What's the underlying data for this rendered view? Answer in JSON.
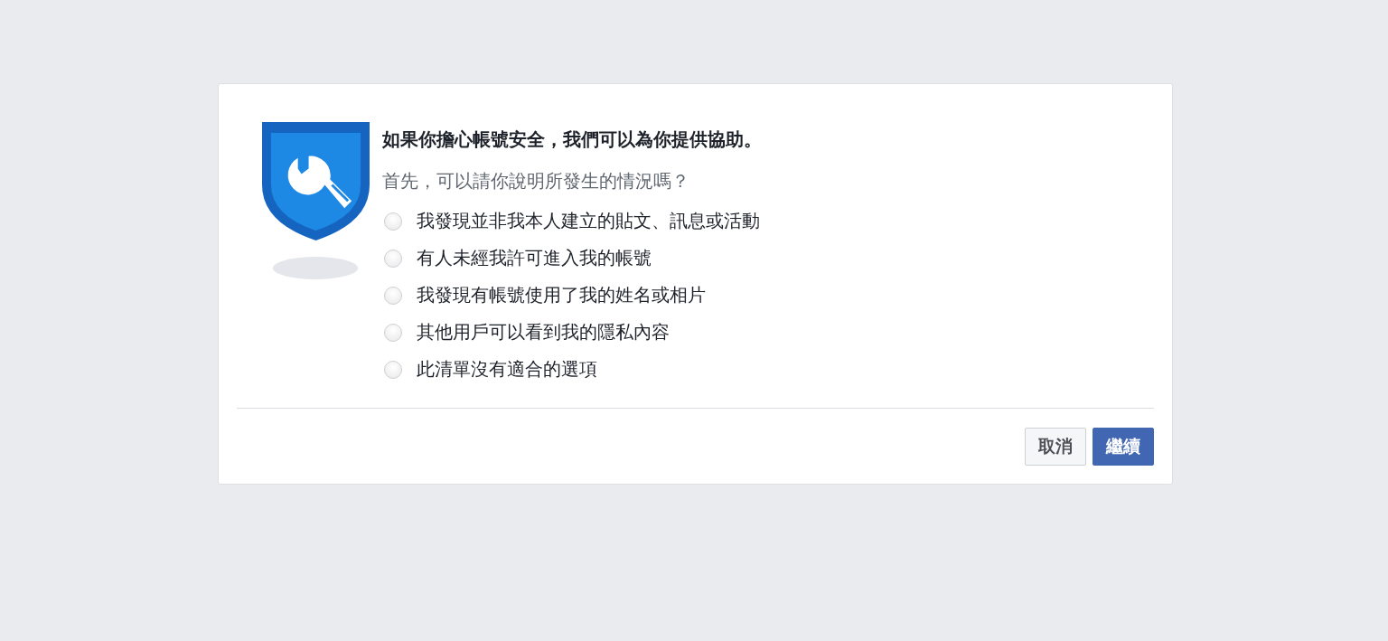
{
  "dialog": {
    "title": "如果你擔心帳號安全，我們可以為你提供協助。",
    "question": "首先，可以請你說明所發生的情況嗎？",
    "options": [
      {
        "label": "我發現並非我本人建立的貼文、訊息或活動",
        "selected": false
      },
      {
        "label": "有人未經我許可進入我的帳號",
        "selected": false
      },
      {
        "label": "我發現有帳號使用了我的姓名或相片",
        "selected": false
      },
      {
        "label": "其他用戶可以看到我的隱私內容",
        "selected": false
      },
      {
        "label": "此清單沒有適合的選項",
        "selected": false
      }
    ],
    "buttons": [
      {
        "label": "取消",
        "kind": "secondary"
      },
      {
        "label": "繼續",
        "kind": "primary"
      }
    ]
  }
}
